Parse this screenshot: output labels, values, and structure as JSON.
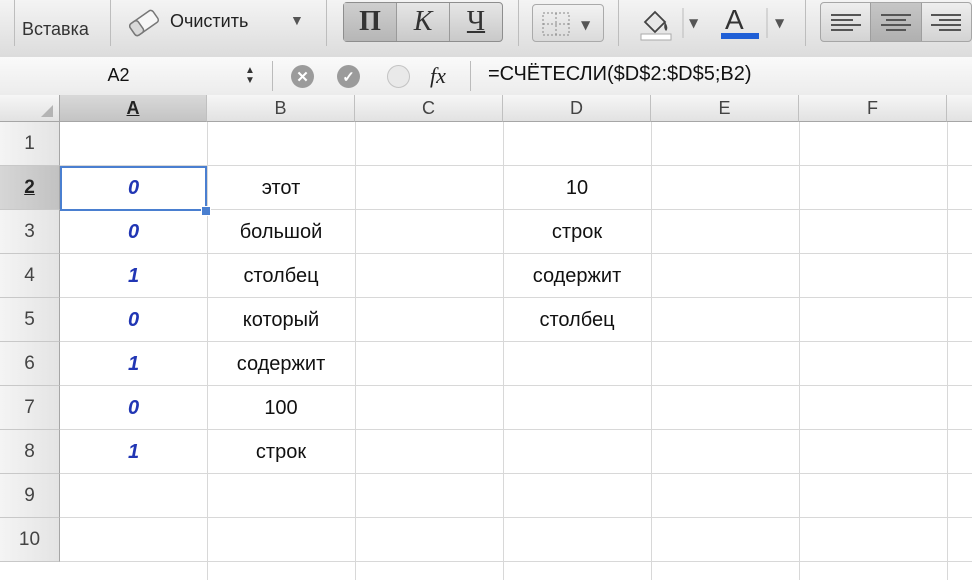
{
  "ribbon": {
    "paste_label": "Вставка",
    "clear_label": "Очистить",
    "bold_label": "П",
    "italic_label": "К",
    "underline_label": "Ч",
    "font_color_label": "A",
    "font_color": "#1f5fd6"
  },
  "formula_bar": {
    "name_box": "A2",
    "fx_label": "fx",
    "formula": "=СЧЁТЕСЛИ($D$2:$D$5;B2)"
  },
  "sheet": {
    "columns": [
      "A",
      "B",
      "C",
      "D",
      "E",
      "F"
    ],
    "rows": [
      "1",
      "2",
      "3",
      "4",
      "5",
      "6",
      "7",
      "8",
      "9",
      "10"
    ],
    "col_a": [
      "",
      "0",
      "0",
      "1",
      "0",
      "1",
      "0",
      "1",
      "",
      ""
    ],
    "col_b": [
      "",
      "этот",
      "большой",
      "столбец",
      "который",
      "содержит",
      "100",
      "строк",
      "",
      ""
    ],
    "col_d": [
      "",
      "10",
      "строк",
      "содержит",
      "столбец",
      "",
      "",
      "",
      "",
      ""
    ],
    "active_cell": "A2"
  }
}
